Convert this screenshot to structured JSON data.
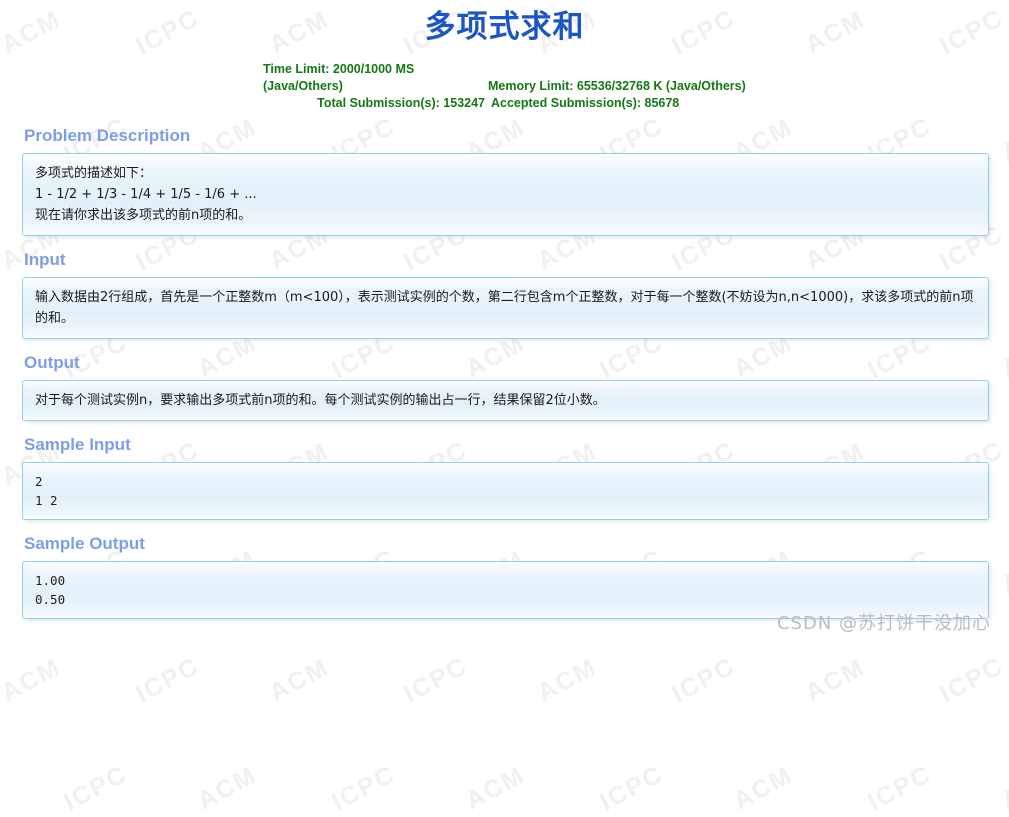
{
  "header": {
    "title": "多项式求和",
    "time_limit": "Time Limit: 2000/1000 MS (Java/Others)",
    "memory_limit": "Memory Limit: 65536/32768 K (Java/Others)",
    "total_submissions": "Total Submission(s): 153247",
    "accepted_submissions": "Accepted Submission(s): 85678"
  },
  "sections": {
    "description": {
      "heading": "Problem Description",
      "line1": "多项式的描述如下：",
      "line2": "1 - 1/2 + 1/3 - 1/4 + 1/5 - 1/6 + ...",
      "line3": "现在请你求出该多项式的前n项的和。"
    },
    "input": {
      "heading": "Input",
      "body": "输入数据由2行组成，首先是一个正整数m（m<100），表示测试实例的个数，第二行包含m个正整数，对于每一个整数(不妨设为n,n<1000)，求该多项式的前n项的和。"
    },
    "output": {
      "heading": "Output",
      "body": "对于每个测试实例n，要求输出多项式前n项的和。每个测试实例的输出占一行，结果保留2位小数。"
    },
    "sample_input": {
      "heading": "Sample Input",
      "body": "2\n1 2"
    },
    "sample_output": {
      "heading": "Sample Output",
      "body": "1.00\n0.50"
    }
  },
  "watermarks": {
    "csdn": "CSDN @苏打饼干没加心",
    "background_tokens": [
      "ACM",
      "ICPC"
    ]
  },
  "colors": {
    "title": "#1b55c6",
    "stats_green": "#147814",
    "heading_blue": "#7c9ee9",
    "panel_border": "#8ad3e8",
    "panel_bg": "#e3f0f9",
    "csdn_gray": "#b9bdc4"
  }
}
